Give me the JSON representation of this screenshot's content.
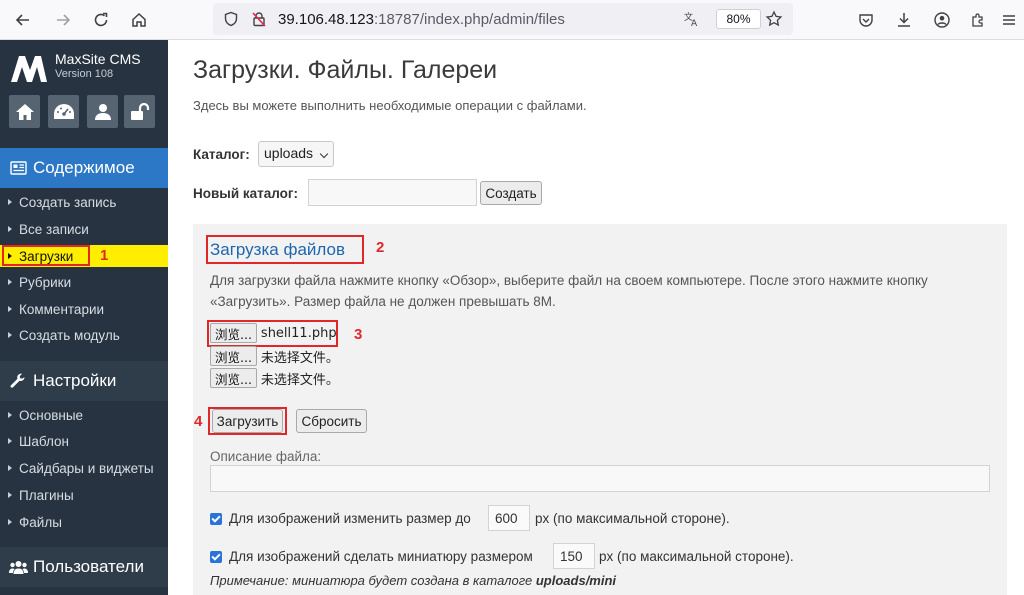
{
  "browser": {
    "url_host": "39.106.48.123",
    "url_path": ":18787/index.php/admin/files",
    "zoom": "80%"
  },
  "sidebar": {
    "brand_name": "MaxSite CMS",
    "brand_version": "Version 108",
    "sections": {
      "content": "Содержимое",
      "settings": "Настройки",
      "users": "Пользователи"
    },
    "content_items": [
      {
        "label": "Создать запись"
      },
      {
        "label": "Все записи"
      },
      {
        "label": "Загрузки"
      },
      {
        "label": "Рубрики"
      },
      {
        "label": "Комментарии"
      },
      {
        "label": "Создать модуль"
      }
    ],
    "settings_items": [
      {
        "label": "Основные"
      },
      {
        "label": "Шаблон"
      },
      {
        "label": "Сайдбары и виджеты"
      },
      {
        "label": "Плагины"
      },
      {
        "label": "Файлы"
      }
    ],
    "active_item": "Загрузки",
    "colors": {
      "background": "#273340",
      "content_header": "#2c78c6",
      "active": "#ffee00"
    }
  },
  "main": {
    "title": "Загрузки. Файлы. Галереи",
    "description": "Здесь вы можете выполнить необходимые операции с файлами.",
    "catalog_label": "Каталог:",
    "catalog_value": "uploads",
    "new_catalog_label": "Новый каталог:",
    "create_button": "Создать",
    "upload": {
      "title": "Загрузка файлов",
      "help_line1": "Для загрузки файла нажмите кнопку «Обзор», выберите файл на своем компьютере. После этого нажмите кнопку",
      "help_line2": "«Загрузить». Размер файла не должен превышать 8M.",
      "files": [
        {
          "browse": "浏览...",
          "name": "shell11.php"
        },
        {
          "browse": "浏览...",
          "name": "未选择文件。"
        },
        {
          "browse": "浏览...",
          "name": "未选择文件。"
        }
      ],
      "submit_button": "Загрузить",
      "reset_button": "Сбросить",
      "file_description_label": "Описание файла:",
      "resize_label_before": "Для изображений изменить размер до",
      "resize_value": "600",
      "resize_label_after": "px (по максимальной стороне).",
      "thumb_label_before": "Для изображений сделать миниатюру размером",
      "thumb_value": "150",
      "thumb_label_after": "px (по максимальной стороне).",
      "note_prefix": "Примечание: миниатюра будет создана в каталоге ",
      "note_path": "uploads/mini"
    }
  },
  "annotations": [
    "1",
    "2",
    "3",
    "4"
  ]
}
